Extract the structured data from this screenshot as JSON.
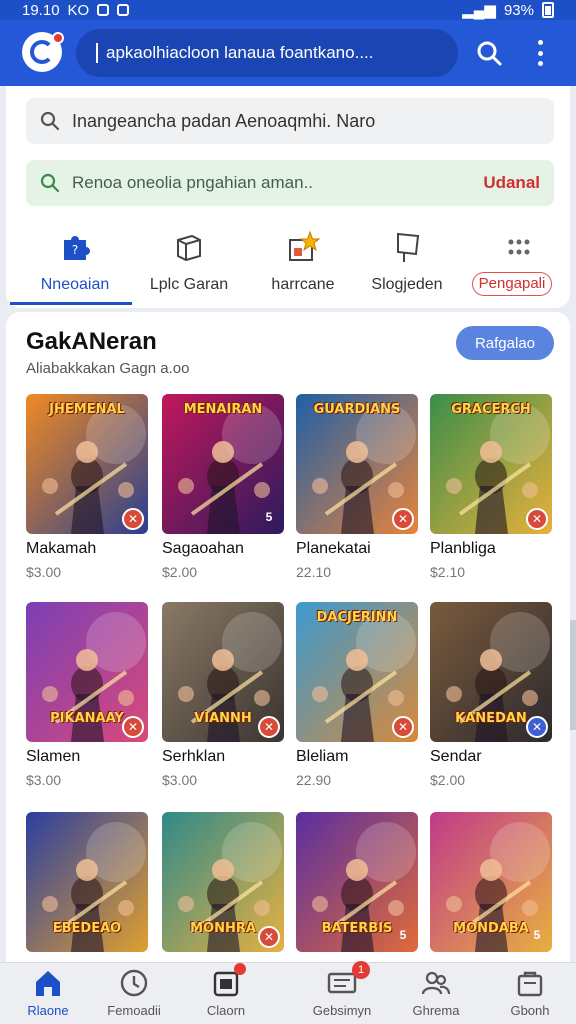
{
  "status_bar": {
    "time": "19.10",
    "left_text": "KO",
    "battery": "93%"
  },
  "app_bar": {
    "search_text": "apkaolhiacloon lanaua foantkano...."
  },
  "search": {
    "placeholder": "Inangeancha padan Aenoaqmhi. Naro"
  },
  "hint": {
    "text": "Renoa oneolia pngahian aman..",
    "action": "Udanal"
  },
  "categories": [
    {
      "label": "Nneoaian",
      "icon": "puzzle-icon",
      "active": true
    },
    {
      "label": "Lplc Garan",
      "icon": "box-icon",
      "active": false
    },
    {
      "label": "harrcane",
      "icon": "star-box-icon",
      "active": false
    },
    {
      "label": "Slogjeden",
      "icon": "flag-icon",
      "active": false
    },
    {
      "label": "Pengapali",
      "icon": "dots-grid-icon",
      "active": false
    }
  ],
  "section": {
    "title": "GakANeran",
    "subtitle": "Aliabakkakan Gagn a.oo",
    "button": "Rafgalao"
  },
  "games": [
    {
      "name": "Makamah",
      "price": "$3.00",
      "art_title": "JHEMENAL",
      "palette": [
        "#f08a24",
        "#2a3f8f"
      ],
      "badge": "red"
    },
    {
      "name": "Sagaoahan",
      "price": "$2.00",
      "art_title": "MENAIRAN",
      "palette": [
        "#c2185b",
        "#2b1a5e"
      ],
      "badge": "dark"
    },
    {
      "name": "Planekatai",
      "price": "22.10",
      "art_title": "GUARDIANS",
      "palette": [
        "#1e5fa8",
        "#e8843a"
      ],
      "badge": "red"
    },
    {
      "name": "Planbliga",
      "price": "$2.10",
      "art_title": "GRACERCH",
      "palette": [
        "#3b8e4a",
        "#e9b03c"
      ],
      "badge": "red"
    },
    {
      "name": "Slamen",
      "price": "$3.00",
      "art_title": "PIKANAAY",
      "palette": [
        "#7b3fb5",
        "#d94a7a"
      ],
      "badge": "red"
    },
    {
      "name": "Serhklan",
      "price": "$3.00",
      "art_title": "VIANNH",
      "palette": [
        "#8a7a66",
        "#3a3430"
      ],
      "badge": "red"
    },
    {
      "name": "Bleliam",
      "price": "22.90",
      "art_title": "DACJERINN",
      "palette": [
        "#3b9ad0",
        "#d8893a"
      ],
      "badge": "red"
    },
    {
      "name": "Sendar",
      "price": "$2.00",
      "art_title": "KANEDAN",
      "palette": [
        "#7a5a3c",
        "#2c2a2e"
      ],
      "badge": "blue"
    },
    {
      "name": "",
      "price": "",
      "art_title": "EBEDEAO",
      "palette": [
        "#2b3fa0",
        "#e0a030"
      ],
      "badge": "none"
    },
    {
      "name": "",
      "price": "",
      "art_title": "MONHRA",
      "palette": [
        "#2e8a8a",
        "#e8b040"
      ],
      "badge": "red"
    },
    {
      "name": "",
      "price": "",
      "art_title": "BATERBIS",
      "palette": [
        "#5a2fa0",
        "#e06a3a"
      ],
      "badge": "dark"
    },
    {
      "name": "",
      "price": "",
      "art_title": "MONDABA",
      "palette": [
        "#c03a8a",
        "#e8b040"
      ],
      "badge": "dark"
    }
  ],
  "bottom_nav": [
    {
      "label": "Rlaone",
      "icon": "home-icon",
      "active": true
    },
    {
      "label": "Femoadii",
      "icon": "clock-icon",
      "active": false
    },
    {
      "label": "Claorn",
      "icon": "store-icon",
      "active": false,
      "dot": true
    },
    {
      "label": "Gebsimyn",
      "icon": "message-icon",
      "active": false,
      "badge": "1"
    },
    {
      "label": "Ghrema",
      "icon": "people-icon",
      "active": false
    },
    {
      "label": "Gbonh",
      "icon": "bag-icon",
      "active": false
    }
  ]
}
